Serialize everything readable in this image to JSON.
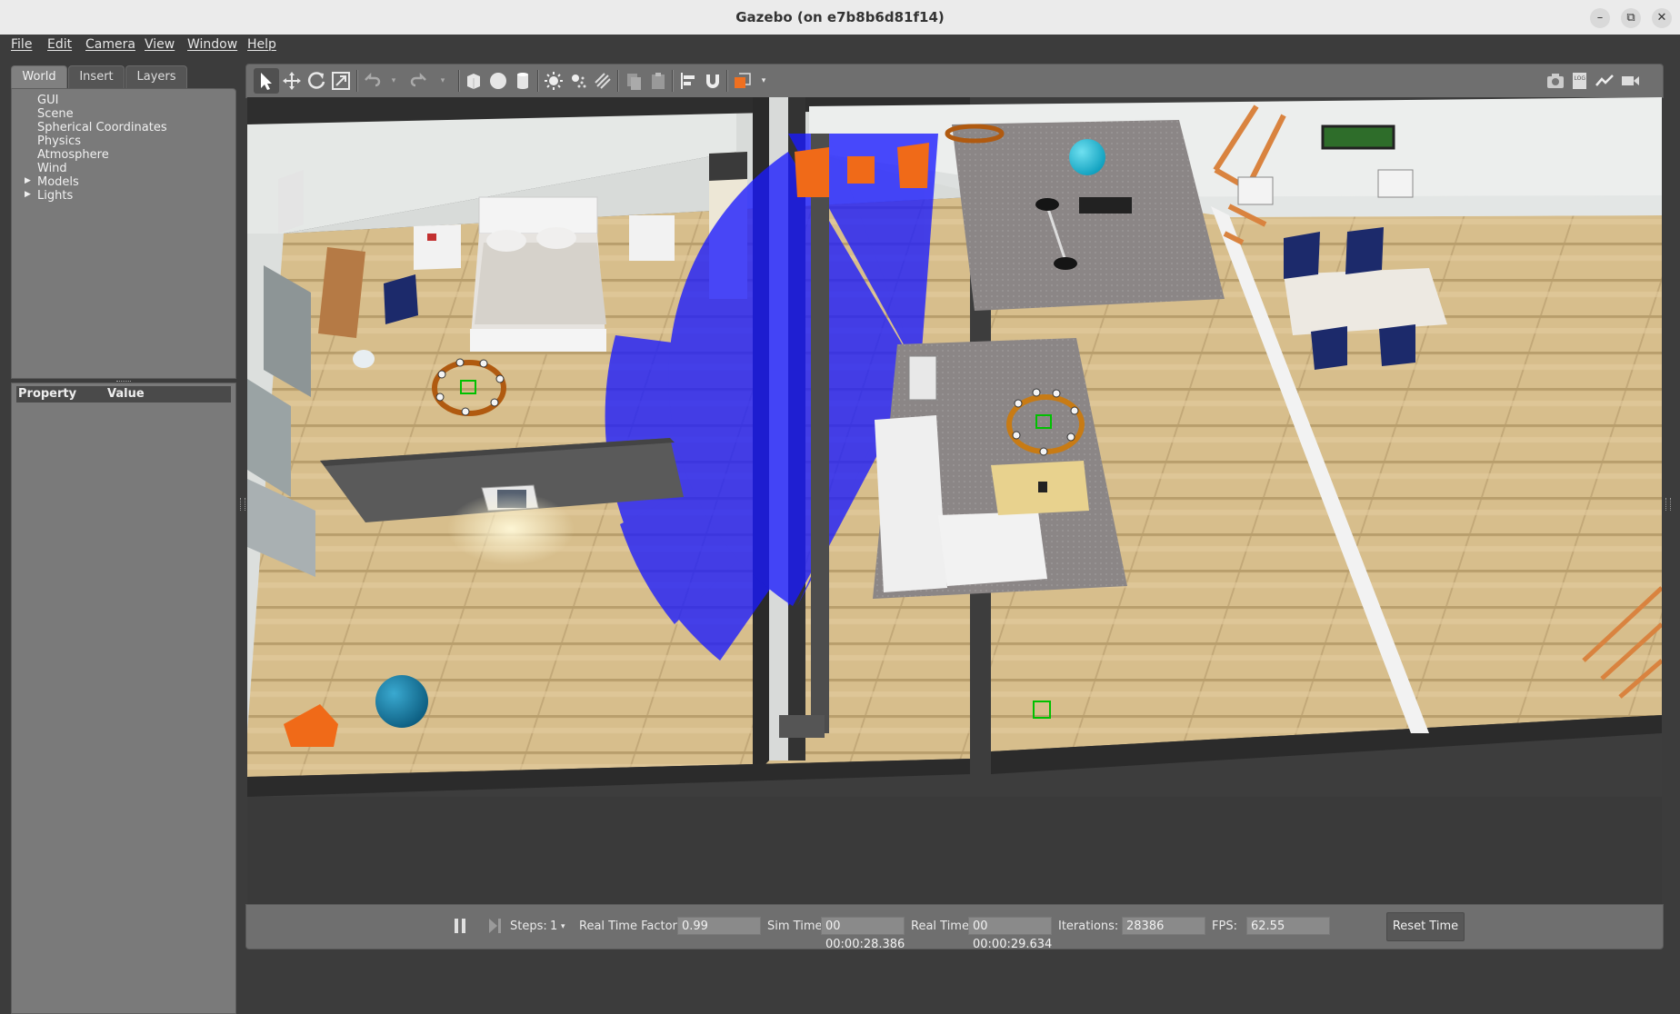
{
  "window": {
    "title": "Gazebo (on e7b8b6d81f14)",
    "minimize_glyph": "–",
    "maximize_glyph": "⧉",
    "close_glyph": "✕"
  },
  "menu": [
    "File",
    "Edit",
    "Camera",
    "View",
    "Window",
    "Help"
  ],
  "left_panel": {
    "tabs": [
      "World",
      "Insert",
      "Layers"
    ],
    "active_tab": "World",
    "tree": [
      "GUI",
      "Scene",
      "Spherical Coordinates",
      "Physics",
      "Atmosphere",
      "Wind",
      "Models",
      "Lights"
    ],
    "property_header": {
      "property": "Property",
      "value": "Value"
    }
  },
  "toolbar": {
    "icons": [
      "select-icon",
      "translate-icon",
      "rotate-icon",
      "scale-icon",
      "undo-icon",
      "redo-icon",
      "box-icon",
      "sphere-icon",
      "cylinder-icon",
      "point-light-icon",
      "spot-light-icon",
      "directional-light-icon",
      "copy-icon",
      "paste-icon",
      "align-icon",
      "snap-icon",
      "view-angle-icon",
      "screenshot-icon",
      "log-icon",
      "plot-icon",
      "video-icon"
    ]
  },
  "status": {
    "steps_label": "Steps:",
    "steps_value": "1",
    "rtf_label": "Real Time Factor:",
    "rtf_value": "0.99",
    "sim_time_label": "Sim Time:",
    "sim_time_value": "00 00:00:28.386",
    "real_time_label": "Real Time:",
    "real_time_value": "00 00:00:29.634",
    "iterations_label": "Iterations:",
    "iterations_value": "28386",
    "fps_label": "FPS:",
    "fps_value": "62.55",
    "reset_label": "Reset Time"
  },
  "colors": {
    "laser": "#1a1aff",
    "floor": "#d8bf8e",
    "wall": "#f2f2f2",
    "chair_orange": "#f06a18",
    "chair_navy": "#1c2a6b"
  }
}
